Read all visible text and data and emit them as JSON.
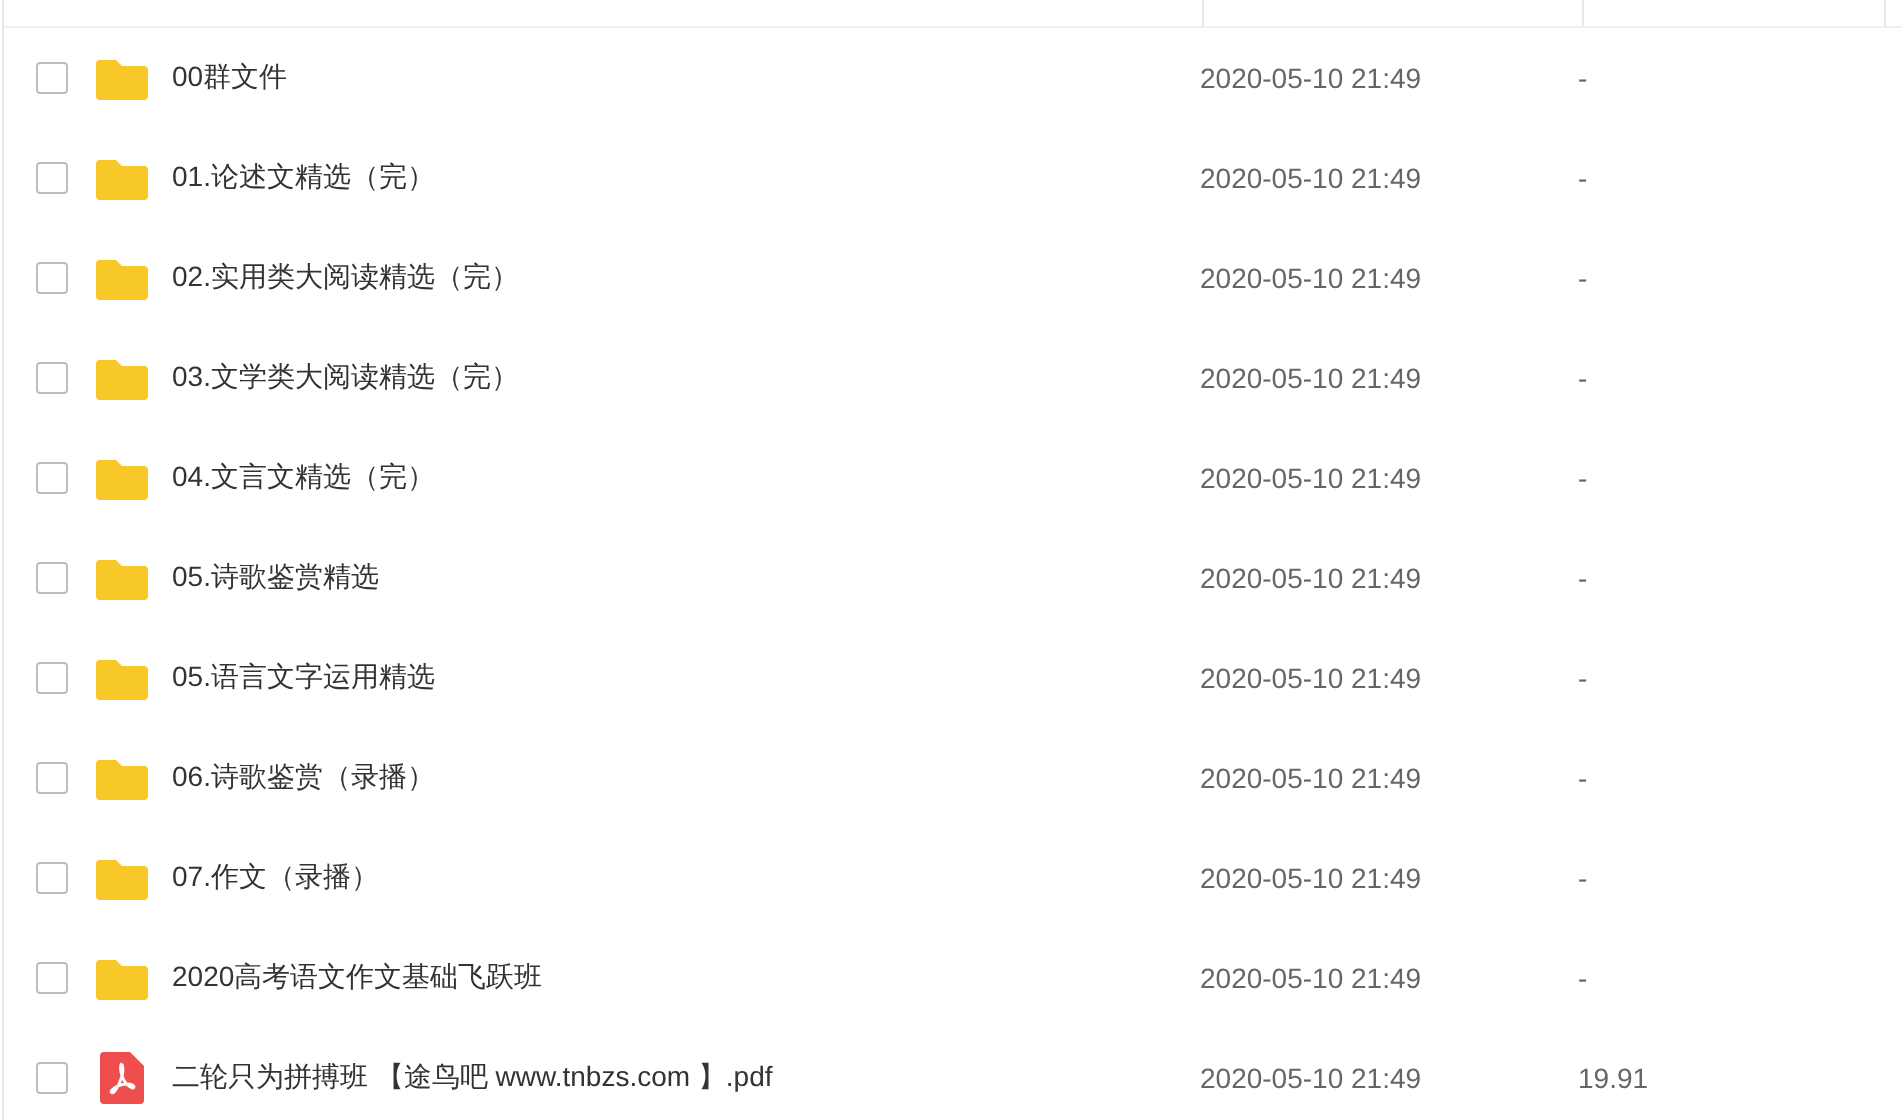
{
  "file_list": {
    "rows": [
      {
        "kind": "folder",
        "checked": false,
        "name": "00群文件",
        "modified": "2020-05-10 21:49",
        "size": "-"
      },
      {
        "kind": "folder",
        "checked": false,
        "name": "01.论述文精选（完）",
        "modified": "2020-05-10 21:49",
        "size": "-"
      },
      {
        "kind": "folder",
        "checked": false,
        "name": "02.实用类大阅读精选（完）",
        "modified": "2020-05-10 21:49",
        "size": "-"
      },
      {
        "kind": "folder",
        "checked": false,
        "name": "03.文学类大阅读精选（完）",
        "modified": "2020-05-10 21:49",
        "size": "-"
      },
      {
        "kind": "folder",
        "checked": false,
        "name": "04.文言文精选（完）",
        "modified": "2020-05-10 21:49",
        "size": "-"
      },
      {
        "kind": "folder",
        "checked": false,
        "name": "05.诗歌鉴赏精选",
        "modified": "2020-05-10 21:49",
        "size": "-"
      },
      {
        "kind": "folder",
        "checked": false,
        "name": "05.语言文字运用精选",
        "modified": "2020-05-10 21:49",
        "size": "-"
      },
      {
        "kind": "folder",
        "checked": false,
        "name": "06.诗歌鉴赏（录播）",
        "modified": "2020-05-10 21:49",
        "size": "-"
      },
      {
        "kind": "folder",
        "checked": false,
        "name": "07.作文（录播）",
        "modified": "2020-05-10 21:49",
        "size": "-"
      },
      {
        "kind": "folder",
        "checked": false,
        "name": "2020高考语文作文基础飞跃班",
        "modified": "2020-05-10 21:49",
        "size": "-"
      },
      {
        "kind": "pdf",
        "checked": false,
        "name": "二轮只为拼搏班 【途鸟吧 www.tnbzs.com 】.pdf",
        "modified": "2020-05-10 21:49",
        "size": "19.91"
      }
    ]
  }
}
